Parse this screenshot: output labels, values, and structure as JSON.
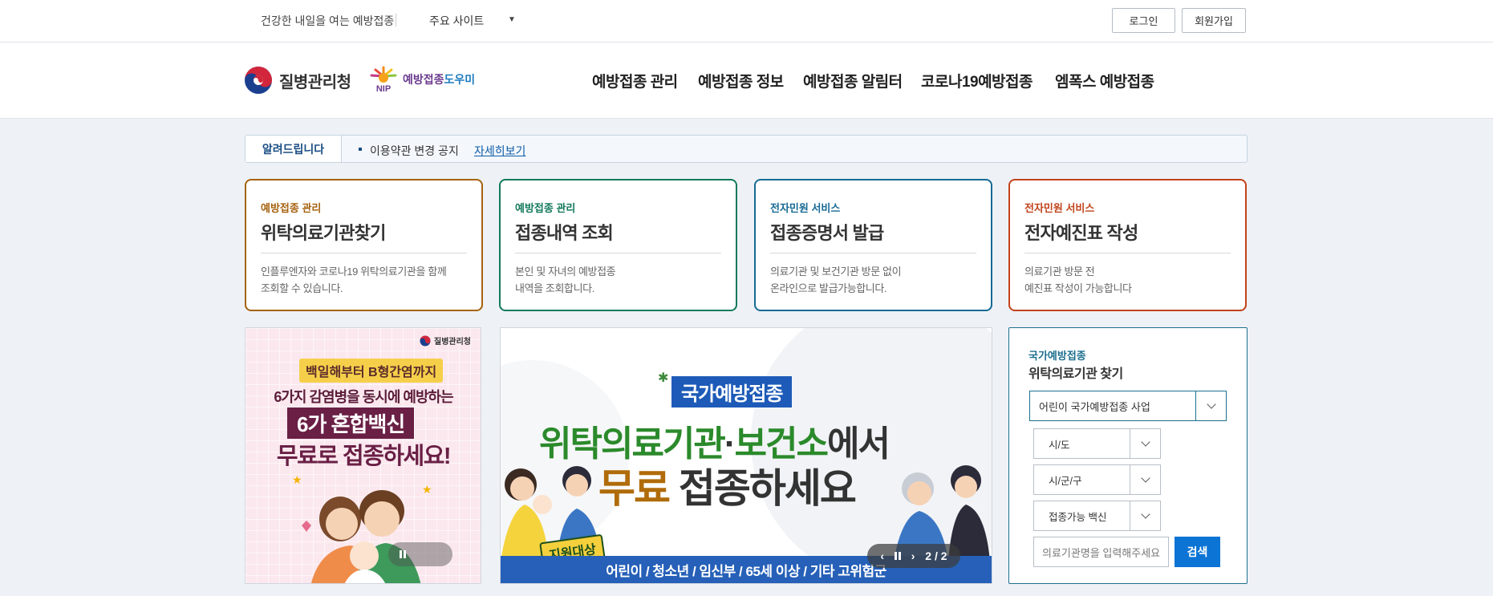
{
  "topbar": {
    "slogan": "건강한 내일을 여는 예방접종",
    "sites": "주요 사이트",
    "login": "로그인",
    "join": "회원가입"
  },
  "header": {
    "org_name": "질병관리청",
    "nip_name_a": "예방접종",
    "nip_name_b": "도우미",
    "nip_mark": "NIP",
    "nav": [
      "예방접종 관리",
      "예방접종 정보",
      "예방접종 알림터",
      "코로나19예방접종",
      "엠폭스 예방접종"
    ]
  },
  "notice": {
    "tag": "알려드립니다",
    "message": "이용약관 변경 공지",
    "more": "자세히보기"
  },
  "cards": [
    {
      "category": "예방접종 관리",
      "title": "위탁의료기관찾기",
      "desc1": "인플루엔자와 코로나19 위탁의료기관을 함께",
      "desc2": "조회할 수 있습니다.",
      "color": "#a6620f"
    },
    {
      "category": "예방접종 관리",
      "title": "접종내역 조회",
      "desc1": "본인 및 자녀의 예방접종",
      "desc2": "내역을 조회합니다.",
      "color": "#137a5c"
    },
    {
      "category": "전자민원 서비스",
      "title": "접종증명서 발급",
      "desc1": "의료기관 및 보건기관 방문 없이",
      "desc2": "온라인으로 발급가능합니다.",
      "color": "#176a94"
    },
    {
      "category": "전자민원 서비스",
      "title": "전자예진표 작성",
      "desc1": "의료기관 방문 전",
      "desc2": "예진표 작성이 가능합니다",
      "color": "#c2431b"
    }
  ],
  "poster": {
    "logo": "질병관리청",
    "pill": "백일해부터 B형간염까지",
    "line1": "6가지 감염병을 동시에 예방하는",
    "line2": "6가 혼합백신",
    "line3": "무료로 접종하세요!"
  },
  "banner": {
    "badge": "국가예방접종",
    "head_a": "위탁의료기관",
    "head_b": "·",
    "head_c": "보건소",
    "head_d": "에서",
    "sub_a": "무료",
    "sub_b": " 접종하세요",
    "target": "지원대상",
    "footer": "어린이 / 청소년 / 임신부 / 65세 이상 / 기타 고위험군",
    "page": "2 / 2"
  },
  "search": {
    "title_small": "국가예방접종",
    "title": "위탁의료기관 찾기",
    "program": "어린이 국가예방접종 사업",
    "sido": "시/도",
    "sigungu": "시/군/구",
    "vaccine": "접종가능 백신",
    "placeholder": "의료기관명을 입력해주세요",
    "button": "검색"
  }
}
